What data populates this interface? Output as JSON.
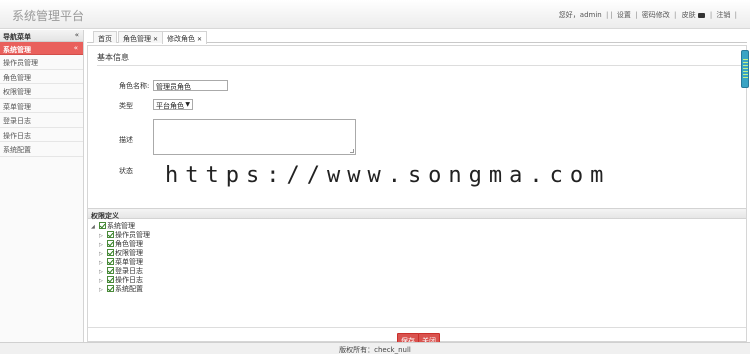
{
  "app": {
    "title": "系统管理平台"
  },
  "toplinks": {
    "welcome": "您好，admin",
    "settings": "设置",
    "change_password": "密码修改",
    "skin": "皮肤",
    "logout": "注销",
    "sep": "|"
  },
  "sidebar": {
    "header": "导航菜单",
    "collapse_glyph": "«",
    "group": {
      "label": "系统管理",
      "chevron": "«"
    },
    "items": [
      {
        "label": "操作员管理"
      },
      {
        "label": "角色管理"
      },
      {
        "label": "权限管理"
      },
      {
        "label": "菜单管理"
      },
      {
        "label": "登录日志"
      },
      {
        "label": "操作日志"
      },
      {
        "label": "系统配置"
      }
    ]
  },
  "tabs": [
    {
      "label": "首页",
      "closable": false
    },
    {
      "label": "角色管理",
      "closable": true
    },
    {
      "label": "修改角色",
      "closable": true,
      "active": true
    }
  ],
  "form": {
    "section_title": "基本信息",
    "role_name_label": "角色名称:",
    "role_name_value": "管理员角色",
    "type_label": "类型",
    "type_value": "平台角色",
    "description_label": "描述",
    "description_value": "",
    "status_label": "状态"
  },
  "permissions": {
    "title": "权限定义",
    "root": {
      "label": "系统管理",
      "checked": true
    },
    "children": [
      {
        "label": "操作员管理",
        "checked": true
      },
      {
        "label": "角色管理",
        "checked": true
      },
      {
        "label": "权限管理",
        "checked": true
      },
      {
        "label": "菜单管理",
        "checked": true
      },
      {
        "label": "登录日志",
        "checked": true
      },
      {
        "label": "操作日志",
        "checked": true
      },
      {
        "label": "系统配置",
        "checked": true
      }
    ]
  },
  "buttons": {
    "save": "保存",
    "close": "关闭"
  },
  "footer": {
    "copyright": "版权所有：check_null"
  },
  "watermark": {
    "text": "https://www.songma.com"
  },
  "icons": {
    "close_tab": "close-icon",
    "dropdown": "chevron-down-icon",
    "skin": "shirt-icon",
    "tree_expand": "triangle-icon"
  },
  "colors": {
    "accent": "#e9605c",
    "button": "#d9534f",
    "checkbox": "#2a7a1a"
  }
}
